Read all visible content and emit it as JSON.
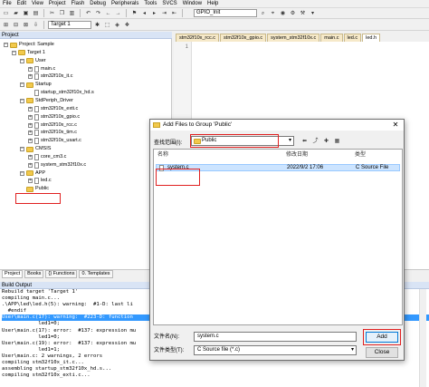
{
  "menubar": [
    "File",
    "Edit",
    "View",
    "Project",
    "Flash",
    "Debug",
    "Peripherals",
    "Tools",
    "SVCS",
    "Window",
    "Help"
  ],
  "toolbar": {
    "function_combo": "GPIO_Init",
    "target_combo": "Target 1"
  },
  "project_panel": {
    "title": "Project",
    "tree": [
      {
        "label": "Project: Sample",
        "depth": 0,
        "kind": "root",
        "expander": "−"
      },
      {
        "label": "Target 1",
        "depth": 1,
        "kind": "target",
        "expander": "−"
      },
      {
        "label": "User",
        "depth": 2,
        "kind": "folder",
        "expander": "−"
      },
      {
        "label": "main.c",
        "depth": 3,
        "kind": "file",
        "expander": "+"
      },
      {
        "label": "stm32f10x_it.c",
        "depth": 3,
        "kind": "file",
        "expander": "+"
      },
      {
        "label": "Startup",
        "depth": 2,
        "kind": "folder",
        "expander": "−"
      },
      {
        "label": "startup_stm32f10x_hd.s",
        "depth": 3,
        "kind": "file",
        "expander": ""
      },
      {
        "label": "StdPeriph_Driver",
        "depth": 2,
        "kind": "folder",
        "expander": "−"
      },
      {
        "label": "stm32f10x_exti.c",
        "depth": 3,
        "kind": "file",
        "expander": "+"
      },
      {
        "label": "stm32f10x_gpio.c",
        "depth": 3,
        "kind": "file",
        "expander": "+"
      },
      {
        "label": "stm32f10x_rcc.c",
        "depth": 3,
        "kind": "file",
        "expander": "+"
      },
      {
        "label": "stm32f10x_tim.c",
        "depth": 3,
        "kind": "file",
        "expander": "+"
      },
      {
        "label": "stm32f10x_usart.c",
        "depth": 3,
        "kind": "file",
        "expander": "+"
      },
      {
        "label": "CMSIS",
        "depth": 2,
        "kind": "folder",
        "expander": "−"
      },
      {
        "label": "core_cm3.c",
        "depth": 3,
        "kind": "file",
        "expander": "+"
      },
      {
        "label": "system_stm32f10x.c",
        "depth": 3,
        "kind": "file",
        "expander": "+"
      },
      {
        "label": "APP",
        "depth": 2,
        "kind": "folder",
        "expander": "−"
      },
      {
        "label": "led.c",
        "depth": 3,
        "kind": "file",
        "expander": "+"
      },
      {
        "label": "Public",
        "depth": 2,
        "kind": "folder",
        "expander": ""
      }
    ]
  },
  "editor": {
    "tabs": [
      "stm32f10x_rcc.c",
      "stm32f10x_gpio.c",
      "system_stm32f10x.c",
      "main.c",
      "led.c",
      "led.h"
    ],
    "line_number": "1"
  },
  "bottom_tabs": [
    "Project",
    "Books",
    "{} Functions",
    "0. Templates"
  ],
  "build_output": {
    "title": "Build Output",
    "lines": [
      "Rebuild target 'Target 1'",
      "compiling main.c...",
      ".\\APP\\led\\led.h(5): warning:  #1-D: last li",
      "  #endif",
      "User\\main.c(17): warning:  #223-D: function",
      "            led1=0;",
      "User\\main.c(17): error:  #137: expression mu",
      "            led1=0;",
      "User\\main.c(19): error:  #137: expression mu",
      "            led1=1;",
      "User\\main.c: 2 warnings, 2 errors",
      "compiling stm32f10x_it.c...",
      "assembling startup_stm32f10x_hd.s...",
      "compiling stm32f10x_exti.c..."
    ],
    "highlight_index": 4
  },
  "dialog": {
    "title": "Add Files to Group 'Public'",
    "close_glyph": "✕",
    "look_in_label": "查找范围(I):",
    "look_in_value": "Public",
    "columns": {
      "name": "名称",
      "date": "修改日期",
      "type": "类型"
    },
    "files": [
      {
        "name": "system.c",
        "date": "2022/9/2 17:06",
        "type": "C Source File"
      }
    ],
    "filename_label": "文件名(N):",
    "filename_value": "system.c",
    "filetype_label": "文件类型(T):",
    "filetype_value": "C Source file (*.c)",
    "add_label": "Add",
    "close_label": "Close"
  },
  "colors": {
    "highlight": "#3399ff",
    "annotation": "#e02020",
    "folder": "#f2c94c"
  }
}
